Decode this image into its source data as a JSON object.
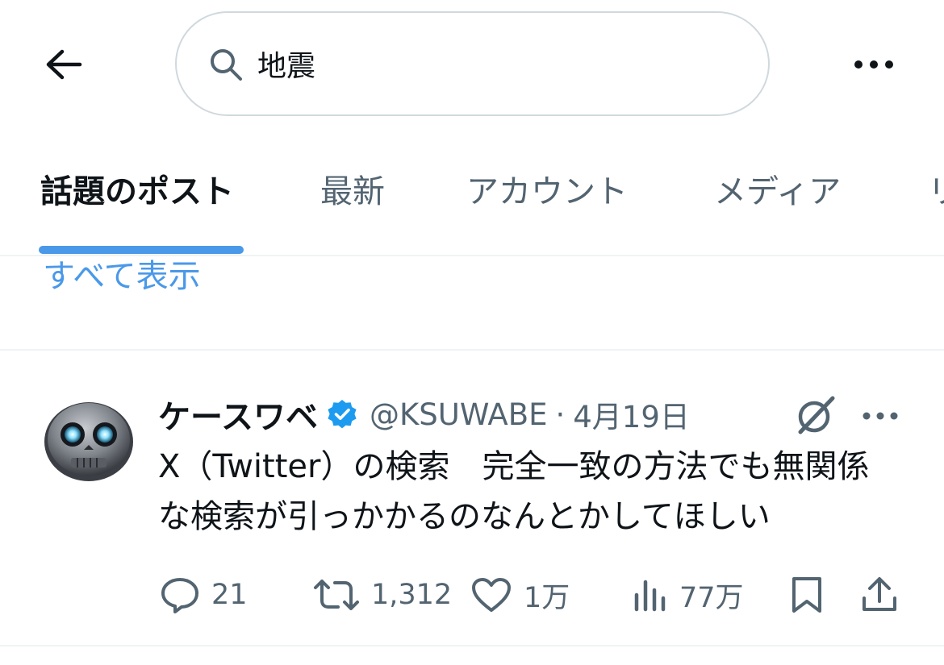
{
  "search": {
    "value": "地震"
  },
  "tabs": [
    {
      "label": "話題のポスト",
      "active": true
    },
    {
      "label": "最新",
      "active": false
    },
    {
      "label": "アカウント",
      "active": false
    },
    {
      "label": "メディア",
      "active": false
    },
    {
      "label": "リ",
      "active": false
    }
  ],
  "show_all_label": "すべて表示",
  "post": {
    "author_name": "ケースワベ",
    "verified": true,
    "handle": "@KSUWABE",
    "separator": "·",
    "date": "4月19日",
    "text": "X（Twitter）の検索　完全一致の方法でも無関係な検索が引っかかるのなんとかしてほしい",
    "actions": {
      "replies": "21",
      "reposts": "1,312",
      "likes": "1万",
      "views": "77万"
    }
  },
  "icons": {
    "back": "arrow-left-icon",
    "search": "search-icon",
    "more": "more-horizontal-icon",
    "verified": "verified-badge-icon",
    "grok": "grok-icon",
    "reply": "reply-icon",
    "repost": "repost-icon",
    "like": "heart-icon",
    "views": "views-icon",
    "bookmark": "bookmark-icon",
    "share": "share-icon"
  },
  "colors": {
    "accent": "#4a99e9",
    "verified": "#1d9bf0",
    "text": "#0f1419",
    "secondary_text": "#536471",
    "divider": "#eff3f4"
  }
}
